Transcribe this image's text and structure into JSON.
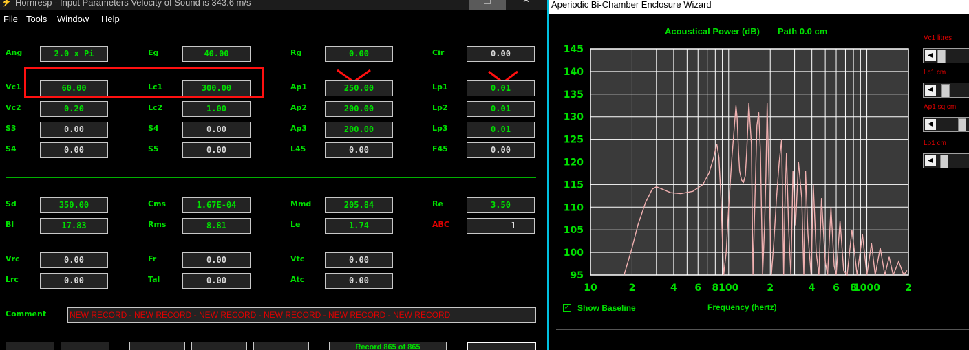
{
  "left_window": {
    "title": "Hornresp - Input Parameters   Velocity of Sound is 343.6 m/s",
    "menu": [
      "File",
      "Tools",
      "Window",
      "Help"
    ],
    "params": [
      {
        "label": "Ang",
        "value": "2.0 x Pi",
        "value_color": "green"
      },
      {
        "label": "Eg",
        "value": "40.00",
        "value_color": "green"
      },
      {
        "label": "Rg",
        "value": "0.00",
        "value_color": "green"
      },
      {
        "label": "Cir",
        "value": "0.00",
        "value_color": "white"
      },
      {
        "label": "Vc1",
        "value": "60.00",
        "value_color": "green"
      },
      {
        "label": "Lc1",
        "value": "300.00",
        "value_color": "green"
      },
      {
        "label": "Ap1",
        "value": "250.00",
        "value_color": "green"
      },
      {
        "label": "Lp1",
        "value": "0.01",
        "value_color": "green"
      },
      {
        "label": "Vc2",
        "value": "0.20",
        "value_color": "green"
      },
      {
        "label": "Lc2",
        "value": "1.00",
        "value_color": "green"
      },
      {
        "label": "Ap2",
        "value": "200.00",
        "value_color": "green"
      },
      {
        "label": "Lp2",
        "value": "0.01",
        "value_color": "green"
      },
      {
        "label": "S3",
        "value": "0.00",
        "value_color": "white"
      },
      {
        "label": "S4",
        "value": "0.00",
        "value_color": "white"
      },
      {
        "label": "Ap3",
        "value": "200.00",
        "value_color": "green"
      },
      {
        "label": "Lp3",
        "value": "0.01",
        "value_color": "green"
      },
      {
        "label": "S4",
        "value": "0.00",
        "value_color": "white"
      },
      {
        "label": "S5",
        "value": "0.00",
        "value_color": "white"
      },
      {
        "label": "L45",
        "value": "0.00",
        "value_color": "white"
      },
      {
        "label": "F45",
        "value": "0.00",
        "value_color": "white"
      },
      {
        "label": "Sd",
        "value": "350.00",
        "value_color": "green"
      },
      {
        "label": "Cms",
        "value": "1.67E-04",
        "value_color": "green"
      },
      {
        "label": "Mmd",
        "value": "205.84",
        "value_color": "green"
      },
      {
        "label": "Re",
        "value": "3.50",
        "value_color": "green"
      },
      {
        "label": "Bl",
        "value": "17.83",
        "value_color": "green"
      },
      {
        "label": "Rms",
        "value": "8.81",
        "value_color": "green"
      },
      {
        "label": "Le",
        "value": "1.74",
        "value_color": "green"
      },
      {
        "label": "ABC",
        "value": "1",
        "value_color": "white"
      },
      {
        "label": "Vrc",
        "value": "0.00",
        "value_color": "white"
      },
      {
        "label": "Fr",
        "value": "0.00",
        "value_color": "white"
      },
      {
        "label": "Vtc",
        "value": "0.00",
        "value_color": "white"
      },
      {
        "label": "Lrc",
        "value": "0.00",
        "value_color": "white"
      },
      {
        "label": "Tal",
        "value": "0.00",
        "value_color": "white"
      },
      {
        "label": "Atc",
        "value": "0.00",
        "value_color": "white"
      }
    ],
    "comment_label": "Comment",
    "comment_value": "NEW RECORD - NEW RECORD - NEW RECORD - NEW RECORD - NEW RECORD - NEW RECORD",
    "record_text": "Record 865 of 865",
    "colors": {
      "green": "#00e000",
      "red": "#e00000",
      "annotation": "#ff1010"
    }
  },
  "right_window": {
    "title": "Aperiodic Bi-Chamber Enclosure Wizard",
    "chart_title_left": "Acoustical Power (dB)",
    "chart_title_right": "Path 0.0 cm",
    "sliders": [
      {
        "label": "Vc1  litres",
        "thumb": 0.0
      },
      {
        "label": "Lc1  cm",
        "thumb": 0.15
      },
      {
        "label": "Ap1  sq cm",
        "thumb": 0.75
      },
      {
        "label": "Lp1  cm",
        "thumb": 0.1
      }
    ],
    "show_baseline_label": "Show Baseline",
    "show_baseline_checked": true,
    "x_axis_label": "Frequency (hertz)"
  },
  "chart_data": {
    "type": "line",
    "title": "Acoustical Power (dB)",
    "xlabel": "Frequency (hertz)",
    "ylabel": "",
    "xscale": "log",
    "xlim": [
      10,
      2000
    ],
    "ylim": [
      95,
      145
    ],
    "yticks": [
      95,
      100,
      105,
      110,
      115,
      120,
      125,
      130,
      135,
      140,
      145
    ],
    "xtick_labels": [
      "10",
      "2",
      "4",
      "6",
      "8",
      "100",
      "2",
      "4",
      "6",
      "8",
      "1000",
      "2"
    ],
    "xtick_values": [
      10,
      20,
      40,
      60,
      80,
      100,
      200,
      400,
      600,
      800,
      1000,
      2000
    ],
    "grid": true,
    "line_color": "#f0b0b0",
    "series": [
      {
        "x": [
          17.5,
          20,
          22,
          25,
          28,
          30,
          33,
          38,
          45,
          55,
          65,
          72,
          78,
          82,
          85,
          88,
          92,
          96,
          100,
          105,
          110,
          113,
          115,
          118,
          120,
          124,
          128,
          132,
          135,
          140,
          146,
          150,
          155,
          160,
          165,
          170,
          176,
          182,
          186,
          190,
          198,
          204,
          212,
          222,
          232,
          242,
          250,
          255,
          262,
          272,
          282,
          292,
          305,
          320,
          338,
          350,
          360,
          375,
          395,
          410,
          430,
          450,
          470,
          500,
          520,
          550,
          580,
          600,
          640,
          680,
          720,
          780,
          850,
          930,
          1000,
          1080,
          1150,
          1250,
          1350,
          1450,
          1550,
          1700,
          1850,
          1950
        ],
        "y": [
          95,
          101,
          106,
          111,
          114,
          114.5,
          114,
          113.2,
          113,
          113.5,
          115,
          117.5,
          121,
          124,
          121,
          112,
          95,
          100,
          110,
          120,
          128,
          132.5,
          130,
          122,
          118,
          116,
          115.5,
          117,
          122,
          133,
          124,
          95,
          112,
          128,
          131,
          122,
          95,
          106,
          117,
          133,
          110,
          95,
          102,
          112,
          120,
          125,
          95,
          110,
          122,
          105,
          95,
          118,
          106,
          120,
          112,
          95,
          118,
          104,
          95,
          115,
          100,
          95,
          112,
          98,
          95,
          110,
          97,
          95,
          107,
          96,
          95,
          105,
          95,
          104,
          95,
          102,
          95,
          101,
          95,
          99,
          95,
          98,
          95,
          96
        ]
      }
    ]
  }
}
